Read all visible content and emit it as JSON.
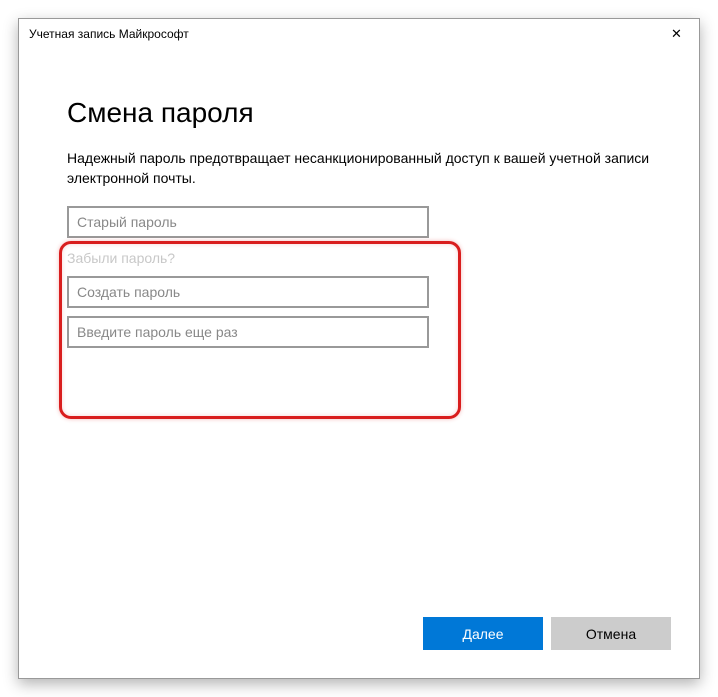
{
  "window": {
    "title": "Учетная запись Майкрософт"
  },
  "page": {
    "heading": "Смена пароля",
    "description": "Надежный пароль предотвращает несанкционированный доступ к вашей учетной записи электронной почты."
  },
  "form": {
    "old_password_placeholder": "Старый пароль",
    "forgot_link": "Забыли пароль?",
    "new_password_placeholder": "Создать пароль",
    "confirm_password_placeholder": "Введите пароль еще раз"
  },
  "buttons": {
    "next": "Далее",
    "cancel": "Отмена"
  }
}
